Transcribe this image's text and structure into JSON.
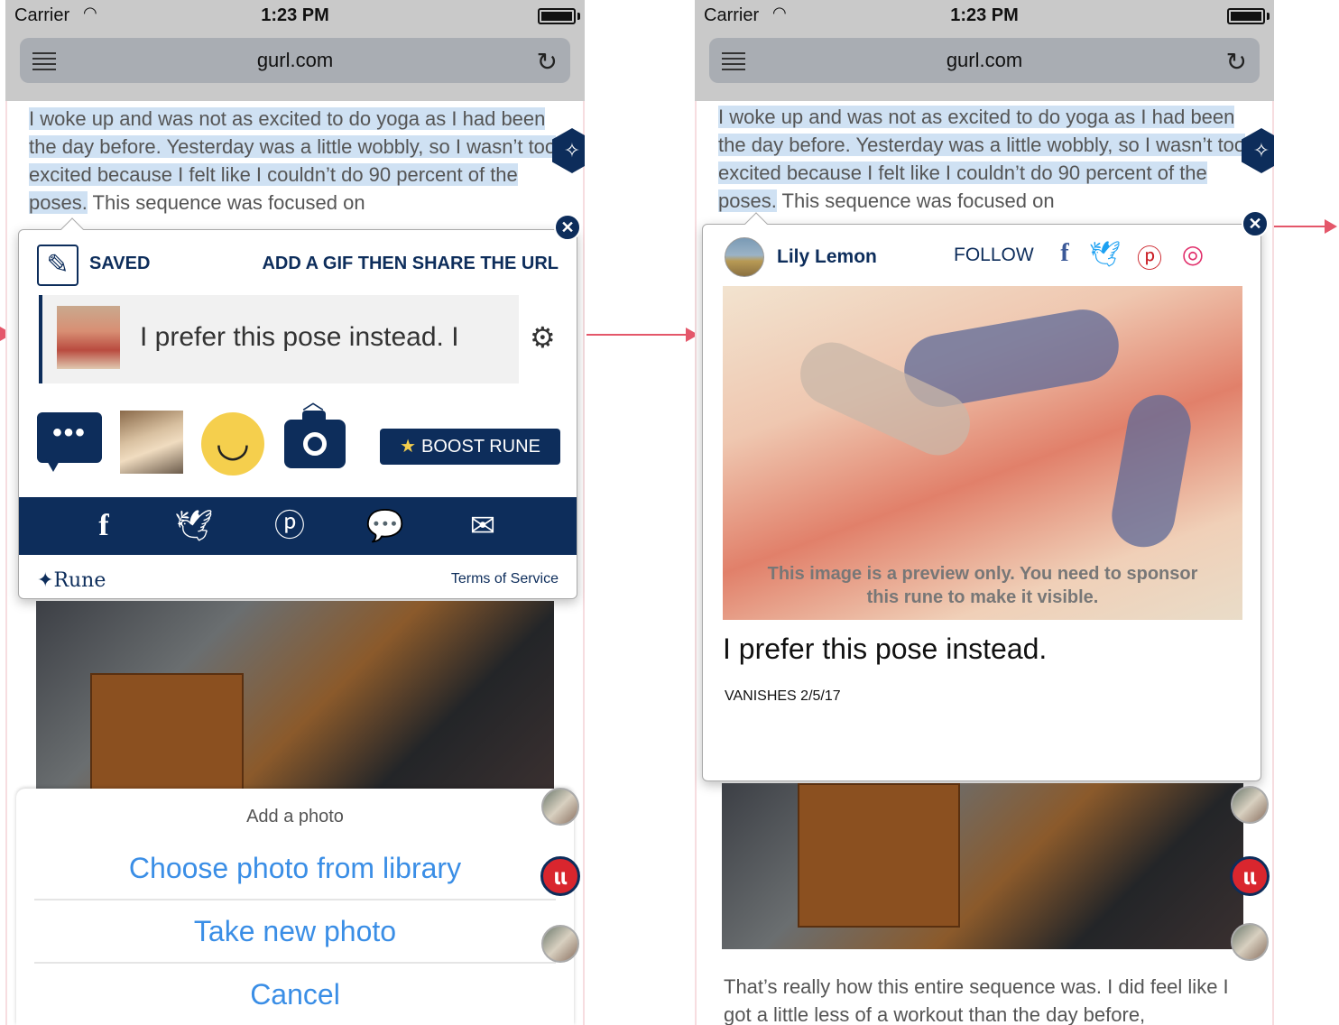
{
  "left_screen": {
    "status": {
      "carrier": "Carrier",
      "time": "1:23 PM"
    },
    "browser": {
      "url": "gurl.com"
    },
    "article": {
      "highlighted_text": "I woke up and was not as excited to do yoga as I had been the day before. Yesterday was a little wobbly, so I wasn’t too excited because I felt like I couldn’t do 90 percent of the poses.",
      "continued_text": " This sequence was focused on"
    },
    "rune_editor": {
      "saved_label": "SAVED",
      "instruction": "ADD A GIF THEN SHARE THE URL",
      "input_value": "I prefer this pose instead. I",
      "boost_label": "BOOST RUNE",
      "brand": "Rune",
      "terms": "Terms of Service"
    },
    "action_sheet": {
      "title": "Add a photo",
      "choose_library": "Choose photo from library",
      "take_photo": "Take new photo",
      "cancel": "Cancel"
    }
  },
  "right_screen": {
    "status": {
      "carrier": "Carrier",
      "time": "1:23 PM"
    },
    "browser": {
      "url": "gurl.com"
    },
    "article": {
      "highlighted_text": "I woke up and was not as excited to do yoga as I had been the day before. Yesterday was a little wobbly, so I wasn’t too excited because I felt like I couldn’t do 90 percent of the poses.",
      "continued_text": " This sequence was focused on",
      "bottom_text": "That’s really how this entire sequence was. I did feel like I got a little less of a workout than the day before,"
    },
    "rune_view": {
      "author": "Lily Lemon",
      "follow_label": "FOLLOW",
      "preview_note": "This image is a preview only. You need to sponsor this rune to make it visible.",
      "quote": "I prefer this pose instead.",
      "vanishes": "VANISHES 2/5/17"
    }
  },
  "icons": [
    "wifi-icon",
    "menu-icon",
    "reload-icon",
    "magic-wand-icon",
    "close-icon",
    "pencil-icon",
    "gear-icon",
    "chat-icon",
    "smiley-icon",
    "camera-icon",
    "facebook-icon",
    "twitter-icon",
    "pinterest-icon",
    "instagram-icon",
    "message-icon",
    "email-icon",
    "star-icon",
    "lululemon-icon"
  ],
  "colors": {
    "navy": "#0d2d5b",
    "highlight": "#cfe1f3",
    "link_blue": "#3a8ee6",
    "arrow": "#e4576a",
    "smiley": "#f5cf4d"
  }
}
